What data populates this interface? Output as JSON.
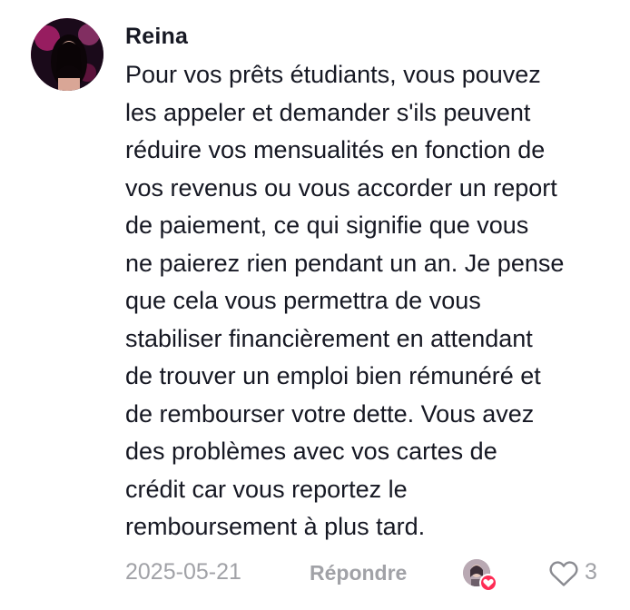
{
  "comment": {
    "username": "Reina",
    "text_lines": [
      "Pour vos prêts étudiants, vous pouvez",
      "les appeler et demander s'ils peuvent",
      "réduire vos mensualités en fonction de",
      "vos revenus ou vous accorder un report",
      "de paiement, ce qui signifie que vous",
      "ne paierez rien pendant un an. Je pense",
      "que cela vous permettra de vous",
      "stabiliser financièrement en attendant",
      "de trouver un emploi bien rémunéré et",
      "de rembourser votre dette. Vous avez",
      "des problèmes avec vos cartes de",
      "crédit car vous reportez le",
      "remboursement à plus tard."
    ],
    "timestamp": "2025-05-21",
    "reply_label": "Répondre",
    "like_count": "3"
  },
  "icons": {
    "avatar": "user-avatar",
    "creator_liked": "creator-avatar-heart-icon",
    "like": "heart-outline-icon"
  },
  "colors": {
    "text": "#161823",
    "muted": "#a1a2a7",
    "heart_badge": "#fe2c55"
  }
}
